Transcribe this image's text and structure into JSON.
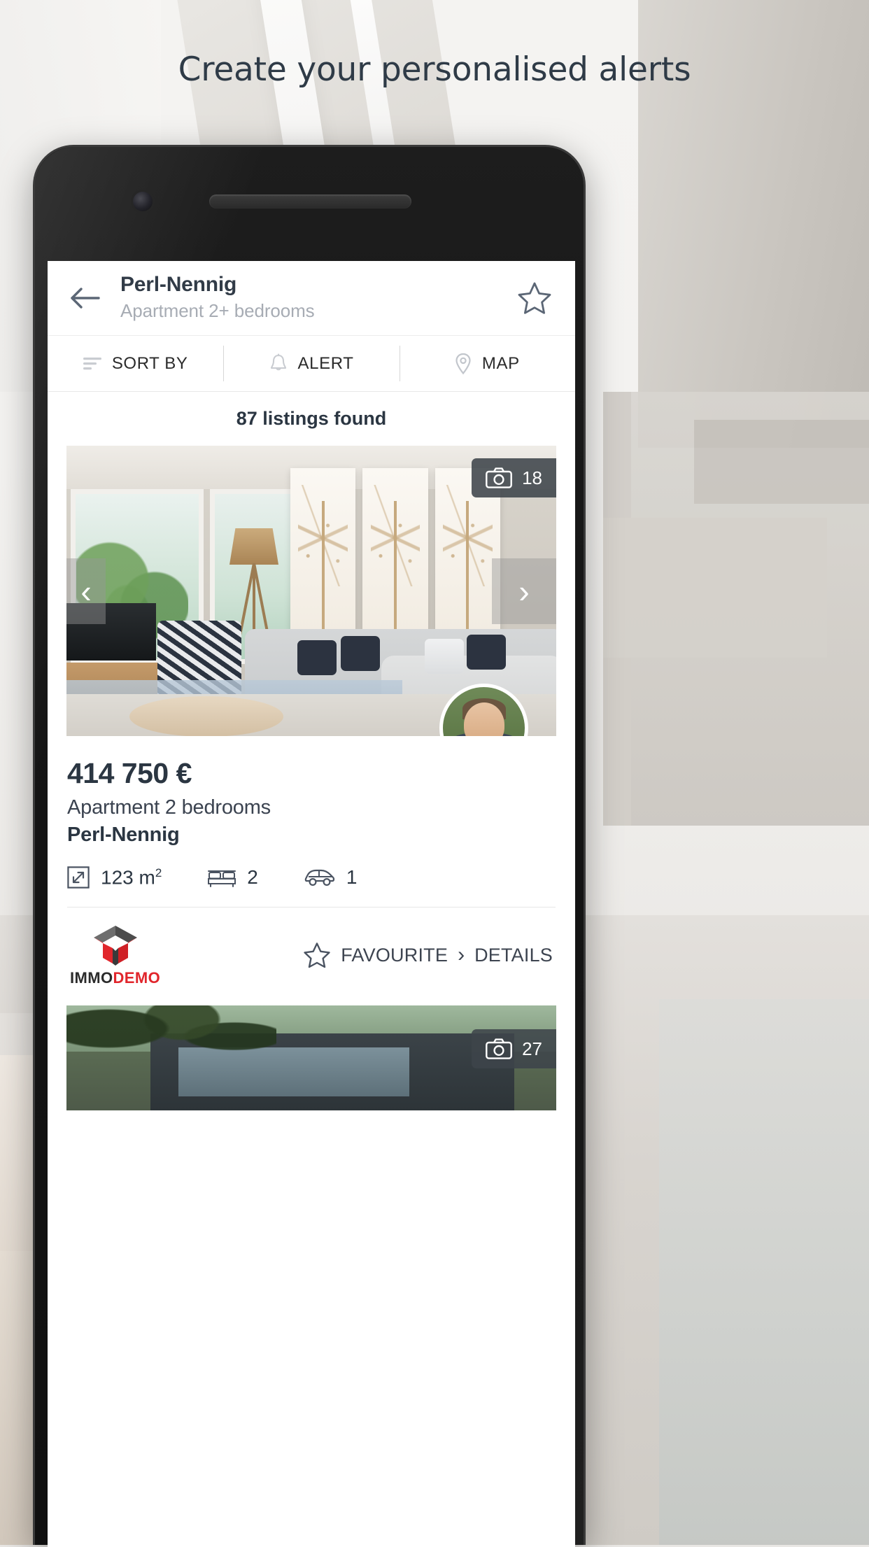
{
  "promo": {
    "headline": "Create your personalised alerts"
  },
  "app": {
    "header": {
      "back_icon": "arrow-left-icon",
      "title": "Perl-Nennig",
      "subtitle": "Apartment 2+ bedrooms",
      "favourite_icon": "star-outline-icon"
    },
    "toolbar": [
      {
        "label": "SORT BY",
        "icon": "sort-icon"
      },
      {
        "label": "ALERT",
        "icon": "bell-icon"
      },
      {
        "label": "MAP",
        "icon": "map-pin-icon"
      }
    ],
    "results": {
      "count_label": "87 listings found"
    },
    "listings": [
      {
        "photo_count": "18",
        "photo_icon": "camera-icon",
        "prev_icon": "chevron-left-icon",
        "next_icon": "chevron-right-icon",
        "agent_avatar": "agent-avatar",
        "price": "414 750 €",
        "type": "Apartment 2 bedrooms",
        "location": "Perl-Nennig",
        "features": [
          {
            "icon": "surface-icon",
            "value": "123 m",
            "unit": "2"
          },
          {
            "icon": "bed-icon",
            "value": "2"
          },
          {
            "icon": "car-icon",
            "value": "1"
          }
        ],
        "agency": {
          "name_primary": "IMMO",
          "name_secondary": "DEMO",
          "logo_icon": "house-logo-icon"
        },
        "actions": {
          "favourite_icon": "star-outline-icon",
          "favourite_label": "FAVOURITE",
          "chevron_icon": "chevron-right-icon",
          "details_label": "DETAILS"
        }
      },
      {
        "photo_count": "27",
        "photo_icon": "camera-icon"
      }
    ]
  },
  "colors": {
    "brand_red": "#e1262c",
    "text_dark": "#2b3642",
    "text_muted": "#a7acb4",
    "badge_bg": "#3e444a"
  }
}
